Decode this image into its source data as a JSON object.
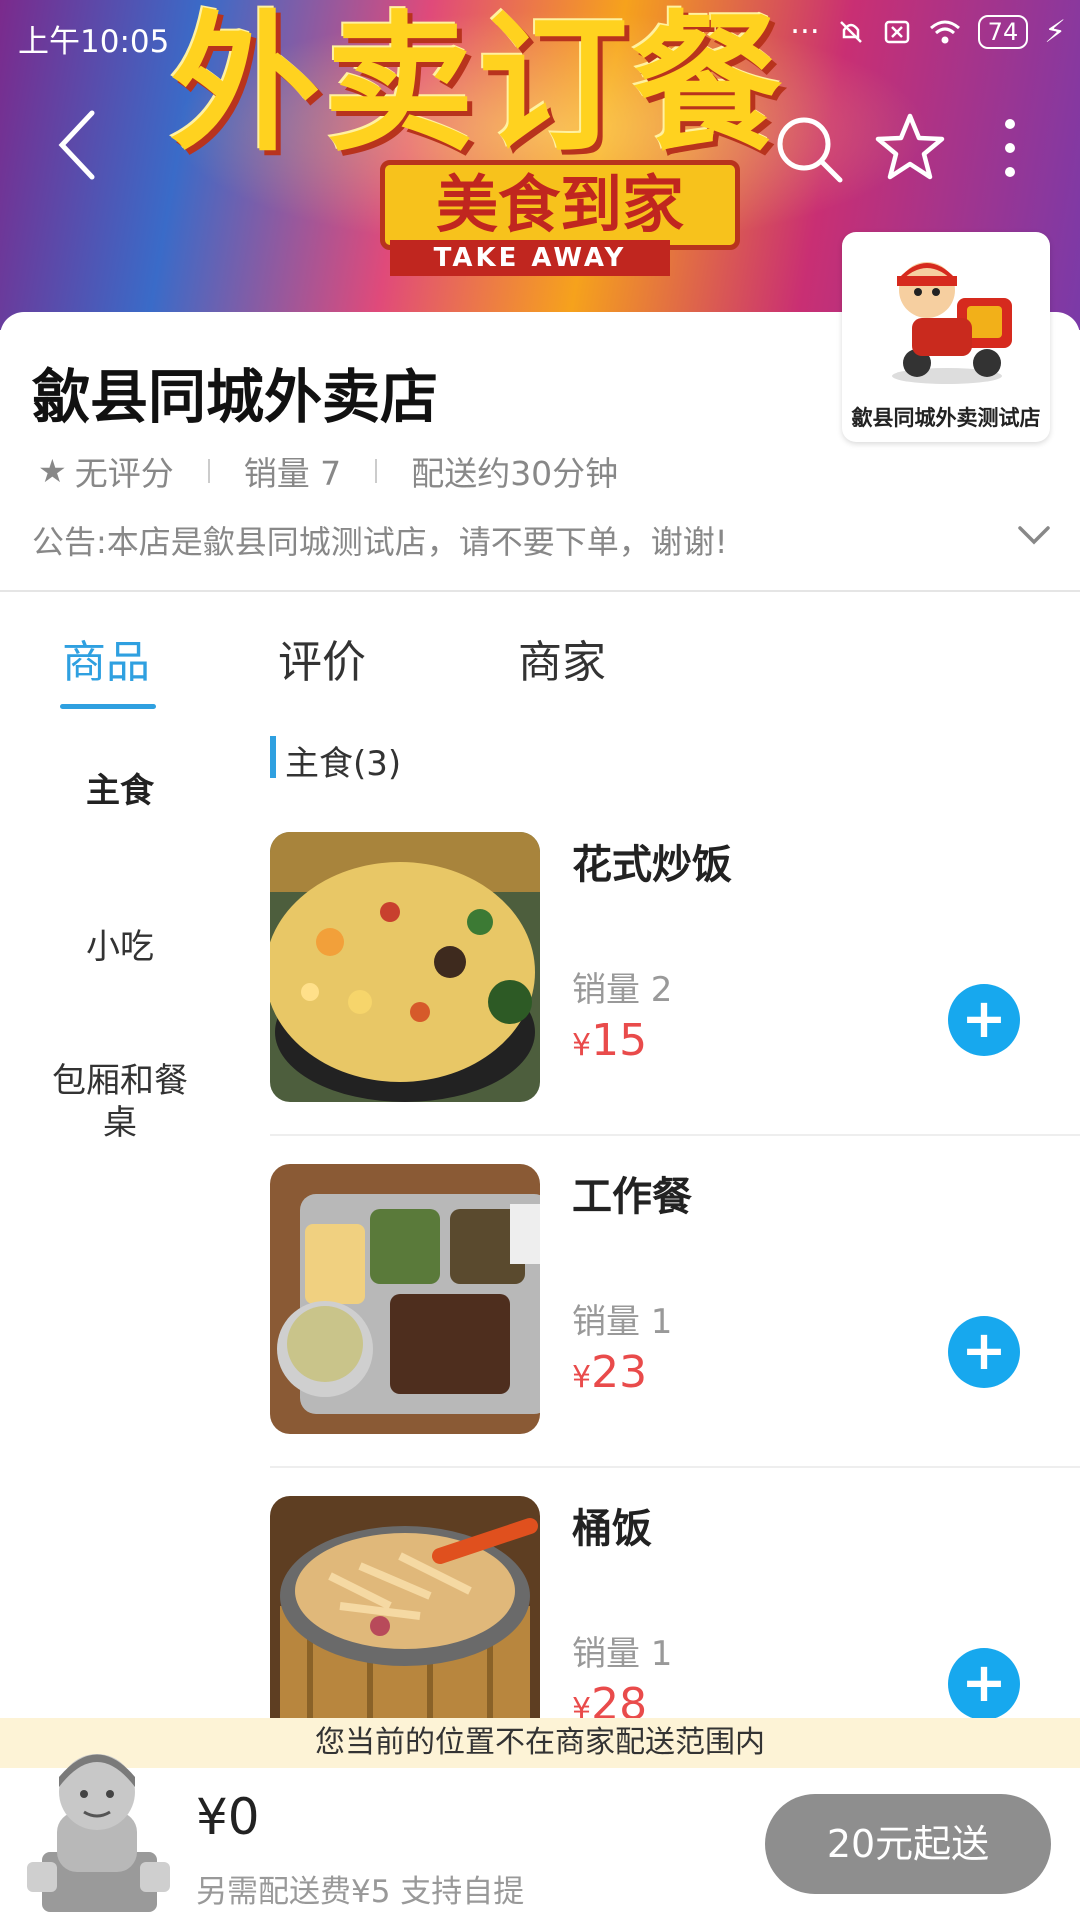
{
  "status_bar": {
    "time": "上午10:05",
    "battery": "74"
  },
  "banner": {
    "title": "外卖订餐",
    "subtitle": "美食到家",
    "tagline": "TAKE AWAY"
  },
  "store": {
    "logo_text": "歙县同城外卖测试店",
    "name": "歙县同城外卖店",
    "rating": "无评分",
    "sales": "销量 7",
    "delivery_time": "配送约30分钟",
    "notice": "公告:本店是歙县同城测试店，请不要下单，谢谢!"
  },
  "tabs": [
    {
      "label": "商品",
      "active": true
    },
    {
      "label": "评价",
      "active": false
    },
    {
      "label": "商家",
      "active": false
    }
  ],
  "categories": [
    {
      "label": "主食",
      "active": true
    },
    {
      "label": "小吃",
      "active": false
    },
    {
      "label": "包厢和餐桌",
      "active": false
    }
  ],
  "section": {
    "title": "主食(3)"
  },
  "products": [
    {
      "name": "花式炒饭",
      "sales": "销量 2",
      "currency": "¥",
      "price": "15"
    },
    {
      "name": "工作餐",
      "sales": "销量 1",
      "currency": "¥",
      "price": "23"
    },
    {
      "name": "桶饭",
      "sales": "销量 1",
      "currency": "¥",
      "price": "28"
    }
  ],
  "range_notice": "您当前的位置不在商家配送范围内",
  "cart": {
    "total": "¥0",
    "delivery_note": "另需配送费¥5  支持自提",
    "checkout_label": "20元起送"
  },
  "colors": {
    "accent": "#2fa0e0",
    "price": "#e94b4b",
    "add_button": "#17a8ee",
    "checkout_disabled": "#8e8e8e"
  }
}
